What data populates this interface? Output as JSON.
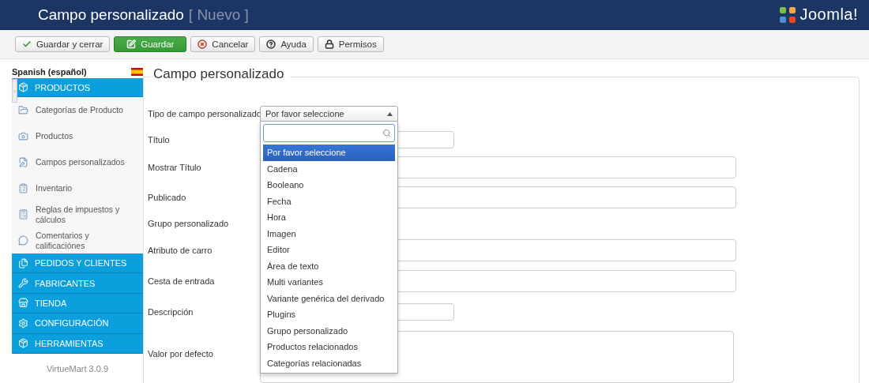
{
  "header": {
    "title": "Campo personalizado",
    "subtitle": "[ Nuevo ]",
    "logo_text": "Joomla!"
  },
  "toolbar": [
    {
      "label": "Guardar y cerrar",
      "kind": "check"
    },
    {
      "label": "Guardar",
      "kind": "primary"
    },
    {
      "label": "Cancelar",
      "kind": "cancel"
    },
    {
      "label": "Ayuda",
      "kind": "help"
    },
    {
      "label": "Permisos",
      "kind": "lock"
    }
  ],
  "sidebar": {
    "language": "Spanish (español)",
    "footer": "VirtueMart 3.0.9",
    "sections": [
      {
        "label": "PRODUCTOS",
        "expanded": true,
        "children": [
          {
            "label": "Categorías de Producto"
          },
          {
            "label": "Productos"
          },
          {
            "label": "Campos personalizados"
          },
          {
            "label": "Inventario"
          },
          {
            "label": "Reglas de impuestos y cálculos"
          },
          {
            "label": "Comentarios y calificaciónes"
          }
        ]
      },
      {
        "label": "PEDIDOS Y CLIENTES",
        "expanded": false
      },
      {
        "label": "FABRICANTES",
        "expanded": false
      },
      {
        "label": "TIENDA",
        "expanded": false
      },
      {
        "label": "CONFIGURACIÓN",
        "expanded": false
      },
      {
        "label": "HERRAMIENTAS",
        "expanded": false
      }
    ]
  },
  "form": {
    "legend": "Campo personalizado",
    "rows": [
      {
        "label": "Tipo de campo personalizado",
        "kind": "select",
        "value": "Por favor seleccione",
        "expanded": true
      },
      {
        "label": "Título",
        "kind": "short"
      },
      {
        "label": "Mostrar Título",
        "kind": "wide"
      },
      {
        "label": "Publicado",
        "kind": "wide"
      },
      {
        "label": "Grupo personalizado",
        "kind": "none"
      },
      {
        "label": "Atributo de carro",
        "kind": "wide"
      },
      {
        "label": "Cesta de entrada",
        "kind": "wide"
      },
      {
        "label": "Descripción",
        "kind": "short"
      },
      {
        "label": "Valor por defecto",
        "kind": "textarea"
      }
    ]
  },
  "dropdown": {
    "options": [
      {
        "label": "Por favor seleccione",
        "selected": true
      },
      {
        "label": "Cadena",
        "selected": false
      },
      {
        "label": "Booleano",
        "selected": false
      },
      {
        "label": "Fecha",
        "selected": false
      },
      {
        "label": "Hora",
        "selected": false
      },
      {
        "label": "Imagen",
        "selected": false
      },
      {
        "label": "Editor",
        "selected": false
      },
      {
        "label": "Área de texto",
        "selected": false
      },
      {
        "label": "Multi variantes",
        "selected": false
      },
      {
        "label": "Variante genérica del derivado",
        "selected": false
      },
      {
        "label": "Plugins",
        "selected": false
      },
      {
        "label": "Grupo personalizado",
        "selected": false
      },
      {
        "label": "Productos relacionados",
        "selected": false
      },
      {
        "label": "Categorías relacionadas",
        "selected": false
      }
    ]
  }
}
